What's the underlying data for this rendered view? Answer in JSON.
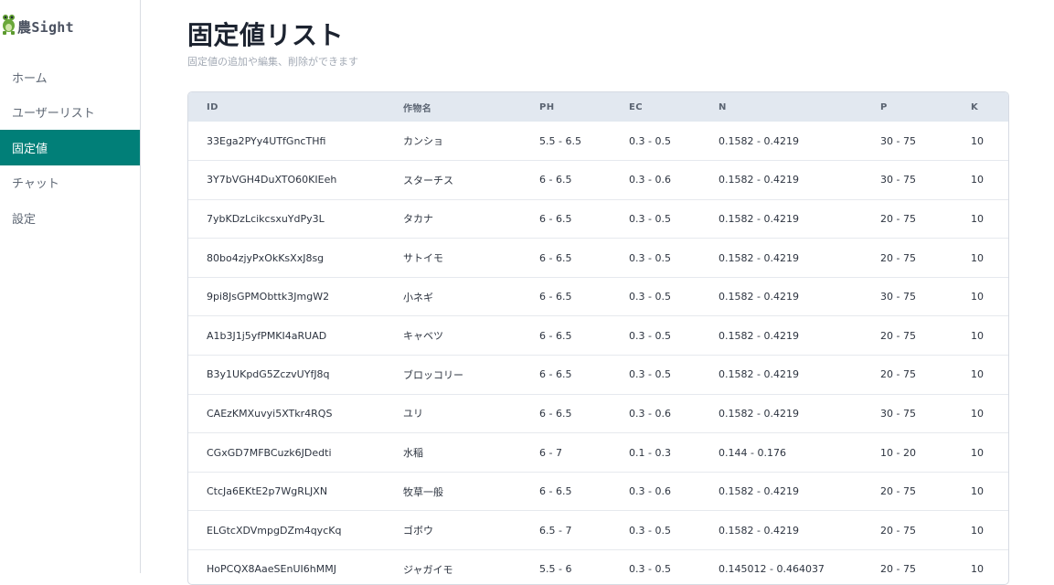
{
  "app": {
    "logo_kanji": "農",
    "logo_text": "Sight"
  },
  "sidebar": {
    "items": [
      {
        "label": "ホーム",
        "active": false
      },
      {
        "label": "ユーザーリスト",
        "active": false
      },
      {
        "label": "固定値",
        "active": true
      },
      {
        "label": "チャット",
        "active": false
      },
      {
        "label": "設定",
        "active": false
      }
    ]
  },
  "page": {
    "title": "固定値リスト",
    "subtitle": "固定値の追加や編集、削除ができます"
  },
  "table": {
    "columns": [
      "ID",
      "作物名",
      "PH",
      "EC",
      "N",
      "P",
      "K"
    ],
    "rows": [
      [
        "33Ega2PYy4UTfGncTHfi",
        "カンショ",
        "5.5 - 6.5",
        "0.3 - 0.5",
        "0.1582 - 0.4219",
        "30 - 75",
        "10"
      ],
      [
        "3Y7bVGH4DuXTO60KIEeh",
        "スターチス",
        "6 - 6.5",
        "0.3 - 0.6",
        "0.1582 - 0.4219",
        "30 - 75",
        "10"
      ],
      [
        "7ybKDzLcikcsxuYdPy3L",
        "タカナ",
        "6 - 6.5",
        "0.3 - 0.5",
        "0.1582 - 0.4219",
        "20 - 75",
        "10"
      ],
      [
        "80bo4zjyPxOkKsXxJ8sg",
        "サトイモ",
        "6 - 6.5",
        "0.3 - 0.5",
        "0.1582 - 0.4219",
        "20 - 75",
        "10"
      ],
      [
        "9pi8JsGPMObttk3JmgW2",
        "小ネギ",
        "6 - 6.5",
        "0.3 - 0.5",
        "0.1582 - 0.4219",
        "30 - 75",
        "10"
      ],
      [
        "A1b3J1j5yfPMKI4aRUAD",
        "キャベツ",
        "6 - 6.5",
        "0.3 - 0.5",
        "0.1582 - 0.4219",
        "20 - 75",
        "10"
      ],
      [
        "B3y1UKpdG5ZczvUYfJ8q",
        "ブロッコリー",
        "6 - 6.5",
        "0.3 - 0.5",
        "0.1582 - 0.4219",
        "20 - 75",
        "10"
      ],
      [
        "CAEzKMXuvyi5XTkr4RQS",
        "ユリ",
        "6 - 6.5",
        "0.3 - 0.6",
        "0.1582 - 0.4219",
        "30 - 75",
        "10"
      ],
      [
        "CGxGD7MFBCuzk6JDedti",
        "水稲",
        "6 - 7",
        "0.1 - 0.3",
        "0.144 - 0.176",
        "10 - 20",
        "10"
      ],
      [
        "CtcJa6EKtE2p7WgRLJXN",
        "牧草一般",
        "6 - 6.5",
        "0.3 - 0.6",
        "0.1582 - 0.4219",
        "20 - 75",
        "10"
      ],
      [
        "ELGtcXDVmpgDZm4qycKq",
        "ゴボウ",
        "6.5 - 7",
        "0.3 - 0.5",
        "0.1582 - 0.4219",
        "20 - 75",
        "10"
      ],
      [
        "HoPCQX8AaeSEnUI6hMMJ",
        "ジャガイモ",
        "5.5 - 6",
        "0.3 - 0.5",
        "0.145012 - 0.464037",
        "20 - 75",
        "10"
      ]
    ]
  },
  "colors": {
    "accent": "#017f78",
    "header_bg": "#e2e8f0"
  },
  "icons": {
    "logo": "frog-icon"
  }
}
